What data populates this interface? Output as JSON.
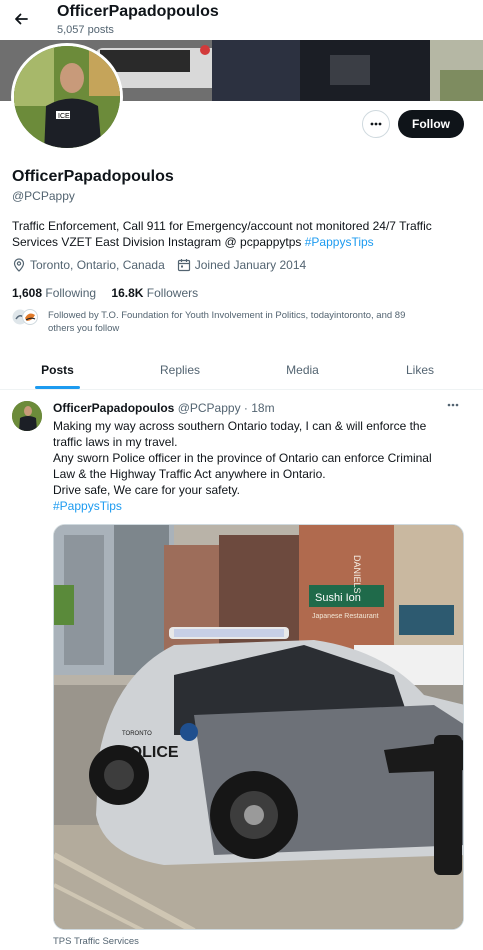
{
  "header": {
    "display_name": "OfficerPapadopoulos",
    "post_count": "5,057 posts"
  },
  "profile": {
    "display_name": "OfficerPapadopoulos",
    "handle": "@PCPappy",
    "follow_label": "Follow",
    "bio_text": "Traffic Enforcement, Call 911 for Emergency/account not monitored 24/7  Traffic Services VZET East Division Instagram @ pcpappytps ",
    "bio_hashtag": "#PappysTips",
    "location": "Toronto, Ontario, Canada",
    "joined": "Joined January 2014",
    "following_count": "1,608",
    "following_label": "Following",
    "followers_count": "16.8K",
    "followers_label": "Followers",
    "followed_by_line1": "Followed by T.O. Foundation for Youth Involvement in Politics, todayintoronto, and 89",
    "followed_by_line2": "others you follow"
  },
  "tabs": [
    {
      "label": "Posts",
      "active": true
    },
    {
      "label": "Replies",
      "active": false
    },
    {
      "label": "Media",
      "active": false
    },
    {
      "label": "Likes",
      "active": false
    }
  ],
  "tweet": {
    "author_name": "OfficerPapadopoulos",
    "author_meta": "@PCPappy · 18m",
    "lines": [
      "Making my way across southern Ontario today, I can & will enforce the",
      "traffic laws in my travel.",
      "Any sworn Police officer in the province of Ontario can enforce Criminal",
      "Law & the Highway Traffic Act anywhere in Ontario.",
      "Drive safe, We care for your safety."
    ],
    "hashtag": "#PappysTips",
    "media_caption": "TPS Traffic Services",
    "image_text": {
      "police": "POLICE",
      "toronto": "TORONTO",
      "store_sign": "Sushi Ion",
      "store_sub": "Japanese Restaurant",
      "building": "DANIELS"
    }
  },
  "colors": {
    "accent": "#1d9bf0",
    "text": "#0f1419",
    "muted": "#536471"
  }
}
